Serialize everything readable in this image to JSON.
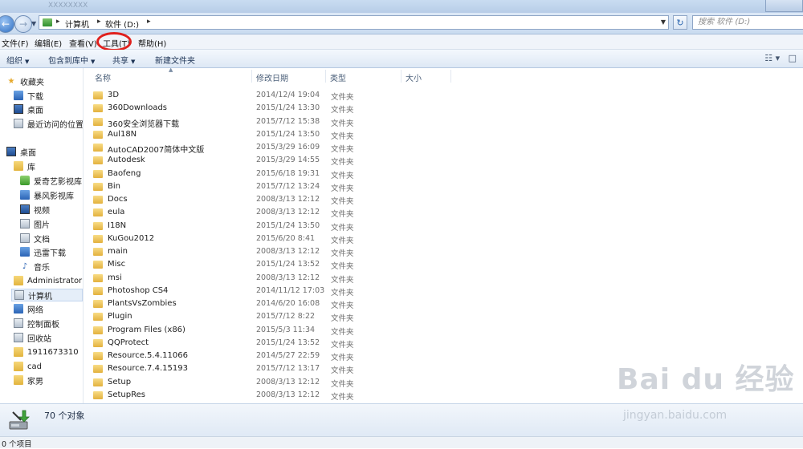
{
  "window": {
    "faded_title": "XXXXXXXX"
  },
  "address": {
    "crumbs": [
      "计算机",
      "软件 (D:)"
    ],
    "search_placeholder": "搜索 软件 (D:)"
  },
  "menubar": {
    "items": [
      "文件(F)",
      "编辑(E)",
      "查看(V)",
      "工具(T)",
      "帮助(H)"
    ],
    "highlighted_item": "工具(T)",
    "highlight_color": "#e0201d"
  },
  "toolbar": {
    "items": [
      "组织",
      "包含到库中",
      "共享",
      "新建文件夹"
    ]
  },
  "nav": {
    "favorites": {
      "label": "收藏夹",
      "items": [
        "下载",
        "桌面",
        "最近访问的位置"
      ]
    },
    "desktop": {
      "label": "桌面"
    },
    "library": {
      "label": "库",
      "items": [
        "爱奇艺影视库",
        "暴风影视库",
        "视频",
        "图片",
        "文档",
        "迅雷下载",
        "音乐"
      ]
    },
    "others": [
      "Administrator",
      "计算机",
      "网络",
      "控制面板",
      "回收站",
      "1911673310",
      "cad",
      "家男"
    ],
    "selected": "计算机"
  },
  "columns": [
    "名称",
    "修改日期",
    "类型",
    "大小"
  ],
  "files": [
    {
      "name": "3D",
      "date": "2014/12/4 19:04",
      "type": "文件夹"
    },
    {
      "name": "360Downloads",
      "date": "2015/1/24 13:30",
      "type": "文件夹"
    },
    {
      "name": "360安全浏览器下载",
      "date": "2015/7/12 15:38",
      "type": "文件夹"
    },
    {
      "name": "Aul18N",
      "date": "2015/1/24 13:50",
      "type": "文件夹"
    },
    {
      "name": "AutoCAD2007简体中文版",
      "date": "2015/3/29 16:09",
      "type": "文件夹"
    },
    {
      "name": "Autodesk",
      "date": "2015/3/29 14:55",
      "type": "文件夹"
    },
    {
      "name": "Baofeng",
      "date": "2015/6/18 19:31",
      "type": "文件夹"
    },
    {
      "name": "Bin",
      "date": "2015/7/12 13:24",
      "type": "文件夹"
    },
    {
      "name": "Docs",
      "date": "2008/3/13 12:12",
      "type": "文件夹"
    },
    {
      "name": "eula",
      "date": "2008/3/13 12:12",
      "type": "文件夹"
    },
    {
      "name": "I18N",
      "date": "2015/1/24 13:50",
      "type": "文件夹"
    },
    {
      "name": "KuGou2012",
      "date": "2015/6/20 8:41",
      "type": "文件夹"
    },
    {
      "name": "main",
      "date": "2008/3/13 12:12",
      "type": "文件夹"
    },
    {
      "name": "Misc",
      "date": "2015/1/24 13:52",
      "type": "文件夹"
    },
    {
      "name": "msi",
      "date": "2008/3/13 12:12",
      "type": "文件夹"
    },
    {
      "name": "Photoshop CS4",
      "date": "2014/11/12 17:03",
      "type": "文件夹"
    },
    {
      "name": "PlantsVsZombies",
      "date": "2014/6/20 16:08",
      "type": "文件夹"
    },
    {
      "name": "Plugin",
      "date": "2015/7/12 8:22",
      "type": "文件夹"
    },
    {
      "name": "Program Files (x86)",
      "date": "2015/5/3 11:34",
      "type": "文件夹"
    },
    {
      "name": "QQProtect",
      "date": "2015/1/24 13:52",
      "type": "文件夹"
    },
    {
      "name": "Resource.5.4.11066",
      "date": "2014/5/27 22:59",
      "type": "文件夹"
    },
    {
      "name": "Resource.7.4.15193",
      "date": "2015/7/12 13:17",
      "type": "文件夹"
    },
    {
      "name": "Setup",
      "date": "2008/3/13 12:12",
      "type": "文件夹"
    },
    {
      "name": "SetupRes",
      "date": "2008/3/13 12:12",
      "type": "文件夹"
    }
  ],
  "details": {
    "count_text": "70 个对象"
  },
  "status": {
    "text": "0 个项目"
  },
  "watermark": {
    "line1": "Bai du 经验",
    "line2": "jingyan.baidu.com"
  }
}
